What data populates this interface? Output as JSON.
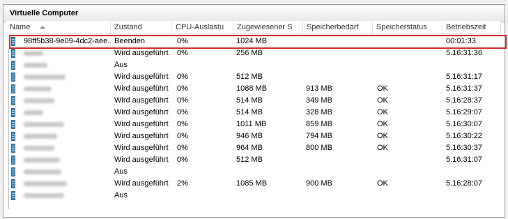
{
  "window": {
    "title": "Virtuelle Computer"
  },
  "columns": [
    "Name",
    "Zustand",
    "CPU-Auslastu",
    "Zugewiesener S",
    "Speicherbedarf",
    "Speicherstatus",
    "Betriebszeit"
  ],
  "vms": [
    {
      "name": "98ff5b38-9e09-4dc2-aee...",
      "state": "Beenden",
      "cpu": "0%",
      "assigned": "1024 MB",
      "demand": "",
      "status": "",
      "uptime": "00:01:33"
    },
    {
      "name": "",
      "state": "Wird ausgeführt",
      "cpu": "0%",
      "assigned": "256 MB",
      "demand": "",
      "status": "",
      "uptime": "5.16:31:36"
    },
    {
      "name": "",
      "state": "Aus",
      "cpu": "",
      "assigned": "",
      "demand": "",
      "status": "",
      "uptime": ""
    },
    {
      "name": "",
      "state": "Wird ausgeführt",
      "cpu": "0%",
      "assigned": "512 MB",
      "demand": "",
      "status": "",
      "uptime": "5.16:31:17"
    },
    {
      "name": "",
      "state": "Wird ausgeführt",
      "cpu": "0%",
      "assigned": "1088 MB",
      "demand": "913 MB",
      "status": "OK",
      "uptime": "5.16:31:37"
    },
    {
      "name": "",
      "state": "Wird ausgeführt",
      "cpu": "0%",
      "assigned": "514 MB",
      "demand": "349 MB",
      "status": "OK",
      "uptime": "5.16:28:37"
    },
    {
      "name": "",
      "state": "Wird ausgeführt",
      "cpu": "0%",
      "assigned": "514 MB",
      "demand": "328 MB",
      "status": "OK",
      "uptime": "5.16:29:07"
    },
    {
      "name": "",
      "state": "Wird ausgeführt",
      "cpu": "0%",
      "assigned": "1011 MB",
      "demand": "859 MB",
      "status": "OK",
      "uptime": "5.16:30:07"
    },
    {
      "name": "",
      "state": "Wird ausgeführt",
      "cpu": "0%",
      "assigned": "946 MB",
      "demand": "794 MB",
      "status": "OK",
      "uptime": "5.16:30:22"
    },
    {
      "name": "",
      "state": "Wird ausgeführt",
      "cpu": "0%",
      "assigned": "964 MB",
      "demand": "800 MB",
      "status": "OK",
      "uptime": "5.16:30:37"
    },
    {
      "name": "",
      "state": "Wird ausgeführt",
      "cpu": "0%",
      "assigned": "512 MB",
      "demand": "",
      "status": "",
      "uptime": "5.16:31:07"
    },
    {
      "name": "",
      "state": "Aus",
      "cpu": "",
      "assigned": "",
      "demand": "",
      "status": "",
      "uptime": ""
    },
    {
      "name": "",
      "state": "Wird ausgeführt",
      "cpu": "2%",
      "assigned": "1085 MB",
      "demand": "900 MB",
      "status": "OK",
      "uptime": "5.16:28:07"
    },
    {
      "name": "",
      "state": "Aus",
      "cpu": "",
      "assigned": "",
      "demand": "",
      "status": "",
      "uptime": ""
    }
  ],
  "colors": {
    "highlight": "#d42a2a",
    "vm_icon": "#3d86b8"
  }
}
